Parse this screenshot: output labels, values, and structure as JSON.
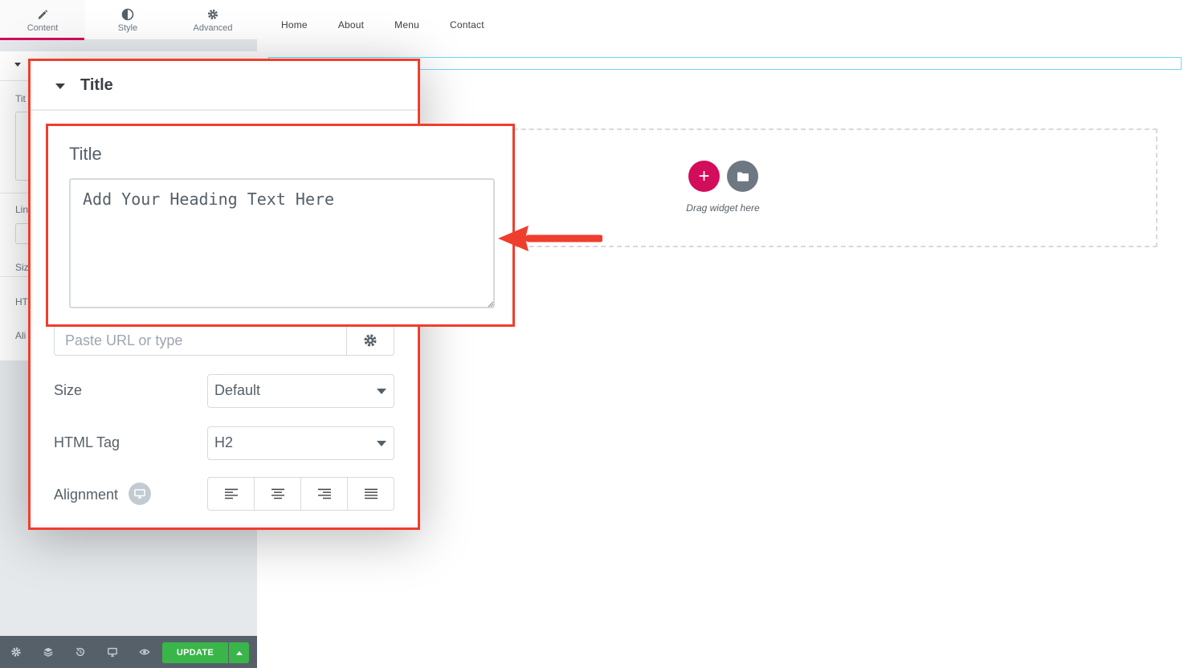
{
  "panel": {
    "tabs": [
      {
        "label": "Content",
        "icon": "pencil-icon",
        "active": true
      },
      {
        "label": "Style",
        "icon": "half-circle-icon",
        "active": false
      },
      {
        "label": "Advanced",
        "icon": "gear-icon",
        "active": false
      }
    ],
    "behind_labels": [
      "Tit",
      "Lin",
      "Siz",
      "HT",
      "Ali"
    ],
    "footer": {
      "icons": [
        "settings-icon",
        "layers-icon",
        "history-icon",
        "responsive-icon",
        "preview-icon"
      ],
      "update_label": "UPDATE"
    }
  },
  "canvas": {
    "nav": [
      "Home",
      "About",
      "Menu",
      "Contact"
    ],
    "dropzone": {
      "add_icon": "+",
      "drag_text": "Drag widget here"
    }
  },
  "zoom_panel": {
    "section_title": "Title",
    "link": {
      "placeholder": "Paste URL or type"
    },
    "size": {
      "label": "Size",
      "value": "Default"
    },
    "html_tag": {
      "label": "HTML Tag",
      "value": "H2"
    },
    "alignment": {
      "label": "Alignment",
      "options": [
        "left",
        "center",
        "right",
        "justify"
      ]
    }
  },
  "title_callout": {
    "label": "Title",
    "placeholder": "Add Your Heading Text Here"
  },
  "colors": {
    "accent": "#d30c5c",
    "callout_border": "#ef3e2d",
    "update_green": "#39b54a",
    "footer_bg": "#556068"
  }
}
